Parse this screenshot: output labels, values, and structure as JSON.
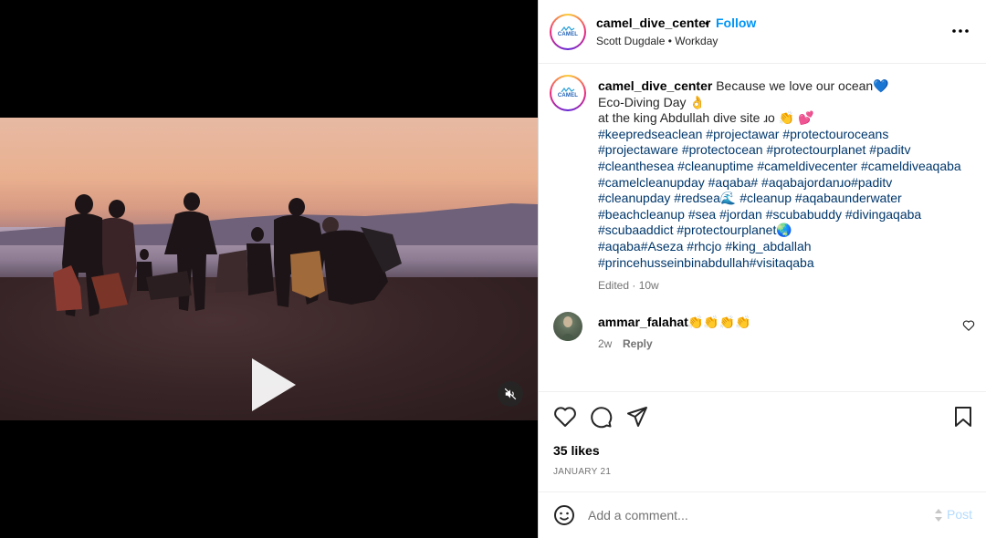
{
  "header": {
    "username": "camel_dive_center",
    "separator": "•",
    "follow_label": "Follow",
    "subtitle": "Scott Dugdale • Workday",
    "avatar_logo_text": "CAMEL",
    "avatar_logo_sub": "DIVE CENTER"
  },
  "caption": {
    "username": "camel_dive_center",
    "lines": [
      "Because we love our ocean💙",
      "Eco-Diving Day 👌",
      "at the king Abdullah dive site ɹo 👏 💕"
    ],
    "hashtag_lines": [
      "#keepredseaclean #projectawar #protectouroceans",
      "#projectaware #protectocean #protectourplanet #paditv",
      "#cleanthesea #cleanuptime #cameldivecenter #cameldiveaqaba",
      "#camelcleanupday #aqaba# #aqabajordanɹo#paditv",
      "#cleanupday #redsea🌊 #cleanup #aqabaunderwater",
      "#beachcleanup #sea #jordan #scubabuddy #divingaqaba",
      "#scubaaddict #protectourplanet🌏",
      "#aqaba#Aseza #rhcjo #king_abdallah",
      "#princehusseinbinabdullah#visitaqaba"
    ],
    "edited_meta": "Edited · 10w"
  },
  "comments": [
    {
      "username": "ammar_falahat",
      "text": "👏👏👏👏",
      "time": "2w",
      "reply_label": "Reply"
    }
  ],
  "actions": {
    "like_icon": "heart-icon",
    "comment_icon": "speech-bubble-icon",
    "share_icon": "paper-plane-icon",
    "save_icon": "bookmark-icon"
  },
  "likes_text": "35 likes",
  "date_text": "JANUARY 21",
  "comment_bar": {
    "placeholder": "Add a comment...",
    "post_label": "Post"
  },
  "colors": {
    "accent": "#0095f6",
    "link": "#00376b",
    "muted": "#737373",
    "post_disabled": "#b3dbff"
  },
  "video": {
    "play_icon": "play-icon",
    "mute_icon": "muted-speaker-icon"
  }
}
